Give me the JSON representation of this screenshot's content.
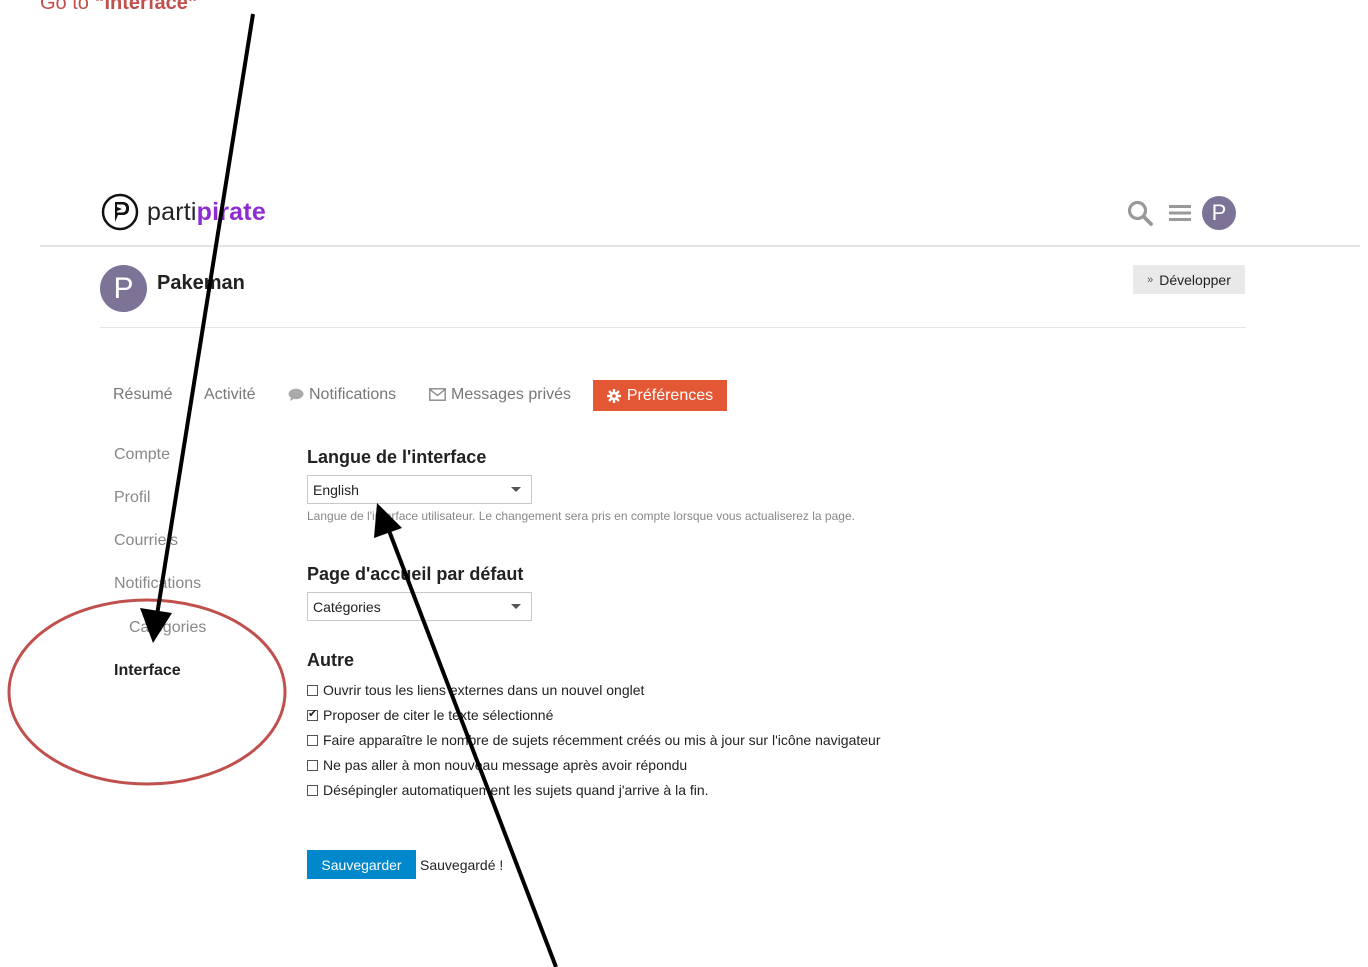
{
  "annotation": {
    "caption_prefix": "Go to ",
    "caption_target": "“Interface”",
    "arrow_color": "#000000",
    "circle_color": "#c0504d"
  },
  "header": {
    "logo_text_1": "parti",
    "logo_text_2": "pirate",
    "avatar_letter": "P",
    "icons": [
      "pirate-logo-icon",
      "search-icon",
      "hamburger-icon"
    ]
  },
  "user": {
    "avatar_letter": "P",
    "name": "Pakeman",
    "expand_label": "Développer"
  },
  "tabs": [
    {
      "label": "Résumé"
    },
    {
      "label": "Activité"
    },
    {
      "label": "Notifications",
      "icon": "comment-icon"
    },
    {
      "label": "Messages privés",
      "icon": "envelope-icon"
    },
    {
      "label": "Préférences",
      "icon": "gear-icon",
      "active": true
    }
  ],
  "sidebar": [
    {
      "label": "Compte"
    },
    {
      "label": "Profil"
    },
    {
      "label": "Courriels"
    },
    {
      "label": "Notifications"
    },
    {
      "label": "Catégories"
    },
    {
      "label": "Interface",
      "active": true
    }
  ],
  "interface_language": {
    "title": "Langue de l'interface",
    "value": "English",
    "help": "Langue de l'interface utilisateur. Le changement sera pris en compte lorsque vous actualiserez la page."
  },
  "default_home": {
    "title": "Page d'accueil par défaut",
    "value": "Catégories"
  },
  "other": {
    "title": "Autre",
    "options": [
      {
        "label": "Ouvrir tous les liens externes dans un nouvel onglet",
        "checked": false
      },
      {
        "label": "Proposer de citer le texte sélectionné",
        "checked": true
      },
      {
        "label": "Faire apparaître le nombre de sujets récemment créés ou mis à jour sur l'icône navigateur",
        "checked": false
      },
      {
        "label": "Ne pas aller à mon nouveau message après avoir répondu",
        "checked": false
      },
      {
        "label": "Désépingler automatiquement les sujets quand j'arrive à la fin.",
        "checked": false
      }
    ]
  },
  "actions": {
    "save_label": "Sauvegarder",
    "saved_label": "Sauvegardé !"
  },
  "colors": {
    "accent_orange": "#e45735",
    "save_blue": "#0088cc",
    "brand_purple": "#8e2bd1",
    "avatar": "#7c7396"
  }
}
